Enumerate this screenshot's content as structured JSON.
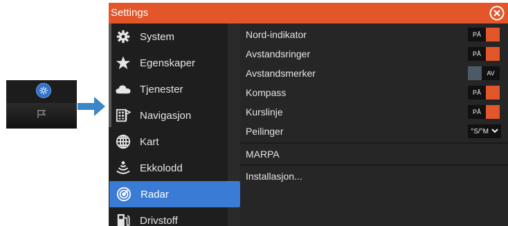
{
  "window": {
    "title": "Settings",
    "close_icon": "close-circle-icon",
    "title_bar_color": "#e2562a"
  },
  "sidebar": {
    "items": [
      {
        "label": "System",
        "icon": "gear-icon"
      },
      {
        "label": "Egenskaper",
        "icon": "star-icon"
      },
      {
        "label": "Tjenester",
        "icon": "cloud-icon"
      },
      {
        "label": "Navigasjon",
        "icon": "navigation-icon"
      },
      {
        "label": "Kart",
        "icon": "globe-icon"
      },
      {
        "label": "Ekkolodd",
        "icon": "sonar-icon"
      },
      {
        "label": "Radar",
        "icon": "radar-icon",
        "selected": true
      },
      {
        "label": "Drivstoff",
        "icon": "fuel-icon"
      }
    ],
    "selected_color": "#3a7bd5"
  },
  "main": {
    "rows": [
      {
        "label": "Nord-indikator",
        "control": "toggle",
        "value": "PÅ",
        "on": true
      },
      {
        "label": "Avstandsringer",
        "control": "toggle",
        "value": "PÅ",
        "on": true
      },
      {
        "label": "Avstandsmerker",
        "control": "toggle",
        "value": "AV",
        "on": false
      },
      {
        "label": "Kompass",
        "control": "toggle",
        "value": "PÅ",
        "on": true
      },
      {
        "label": "Kurslinje",
        "control": "toggle",
        "value": "PÅ",
        "on": true
      },
      {
        "label": "Peilinger",
        "control": "dropdown",
        "value": "°S/°M"
      },
      {
        "label": "MARPA",
        "control": "link"
      },
      {
        "label": "Installasjon...",
        "control": "link"
      }
    ],
    "toggle_on_color": "#e2562a"
  }
}
